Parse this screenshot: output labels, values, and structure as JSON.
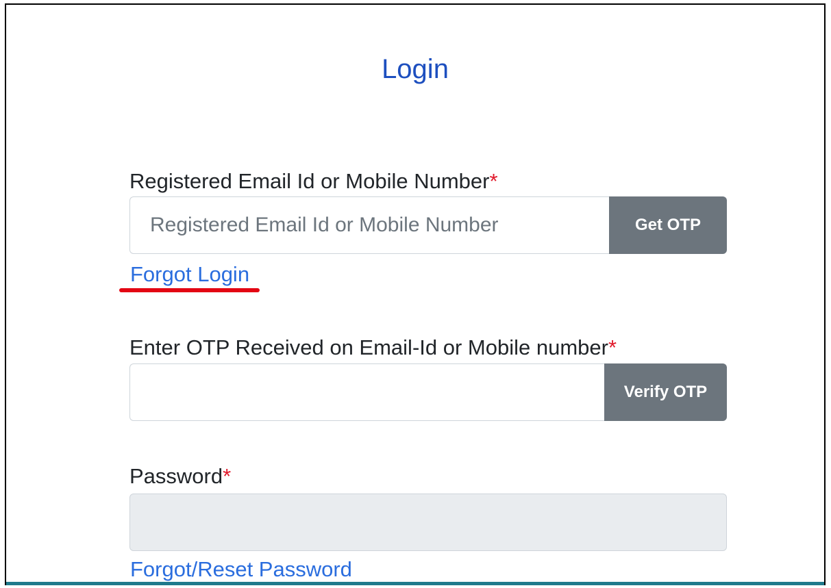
{
  "page_title": "Login",
  "email_field": {
    "label": "Registered Email Id or Mobile Number",
    "required_mark": "*",
    "placeholder": "Registered Email Id or Mobile Number",
    "value": "",
    "button_label": "Get OTP"
  },
  "forgot_login_label": "Forgot Login",
  "otp_field": {
    "label": "Enter OTP Received on Email-Id or Mobile number",
    "required_mark": "*",
    "placeholder": "",
    "value": "",
    "button_label": "Verify OTP"
  },
  "password_field": {
    "label": "Password",
    "required_mark": "*",
    "value": "",
    "disabled": true
  },
  "forgot_password_label": "Forgot/Reset Password",
  "colors": {
    "title": "#1d4fbf",
    "link": "#2a6dde",
    "required": "#e0192b",
    "button_bg": "#6c757d",
    "disabled_input_bg": "#e9ecef",
    "annotation_underline": "#e30613",
    "bottom_bar": "#1f7a8c"
  }
}
